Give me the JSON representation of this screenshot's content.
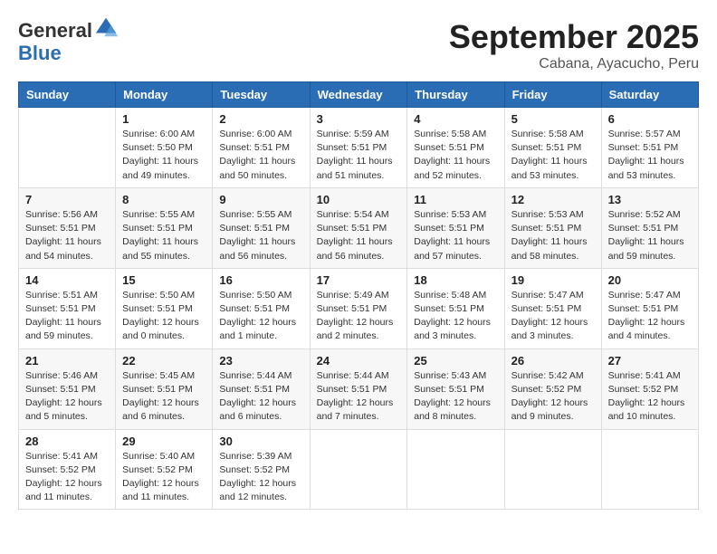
{
  "header": {
    "logo_general": "General",
    "logo_blue": "Blue",
    "month_year": "September 2025",
    "location": "Cabana, Ayacucho, Peru"
  },
  "weekdays": [
    "Sunday",
    "Monday",
    "Tuesday",
    "Wednesday",
    "Thursday",
    "Friday",
    "Saturday"
  ],
  "weeks": [
    [
      {
        "day": "",
        "info": ""
      },
      {
        "day": "1",
        "info": "Sunrise: 6:00 AM\nSunset: 5:50 PM\nDaylight: 11 hours\nand 49 minutes."
      },
      {
        "day": "2",
        "info": "Sunrise: 6:00 AM\nSunset: 5:51 PM\nDaylight: 11 hours\nand 50 minutes."
      },
      {
        "day": "3",
        "info": "Sunrise: 5:59 AM\nSunset: 5:51 PM\nDaylight: 11 hours\nand 51 minutes."
      },
      {
        "day": "4",
        "info": "Sunrise: 5:58 AM\nSunset: 5:51 PM\nDaylight: 11 hours\nand 52 minutes."
      },
      {
        "day": "5",
        "info": "Sunrise: 5:58 AM\nSunset: 5:51 PM\nDaylight: 11 hours\nand 53 minutes."
      },
      {
        "day": "6",
        "info": "Sunrise: 5:57 AM\nSunset: 5:51 PM\nDaylight: 11 hours\nand 53 minutes."
      }
    ],
    [
      {
        "day": "7",
        "info": "Sunrise: 5:56 AM\nSunset: 5:51 PM\nDaylight: 11 hours\nand 54 minutes."
      },
      {
        "day": "8",
        "info": "Sunrise: 5:55 AM\nSunset: 5:51 PM\nDaylight: 11 hours\nand 55 minutes."
      },
      {
        "day": "9",
        "info": "Sunrise: 5:55 AM\nSunset: 5:51 PM\nDaylight: 11 hours\nand 56 minutes."
      },
      {
        "day": "10",
        "info": "Sunrise: 5:54 AM\nSunset: 5:51 PM\nDaylight: 11 hours\nand 56 minutes."
      },
      {
        "day": "11",
        "info": "Sunrise: 5:53 AM\nSunset: 5:51 PM\nDaylight: 11 hours\nand 57 minutes."
      },
      {
        "day": "12",
        "info": "Sunrise: 5:53 AM\nSunset: 5:51 PM\nDaylight: 11 hours\nand 58 minutes."
      },
      {
        "day": "13",
        "info": "Sunrise: 5:52 AM\nSunset: 5:51 PM\nDaylight: 11 hours\nand 59 minutes."
      }
    ],
    [
      {
        "day": "14",
        "info": "Sunrise: 5:51 AM\nSunset: 5:51 PM\nDaylight: 11 hours\nand 59 minutes."
      },
      {
        "day": "15",
        "info": "Sunrise: 5:50 AM\nSunset: 5:51 PM\nDaylight: 12 hours\nand 0 minutes."
      },
      {
        "day": "16",
        "info": "Sunrise: 5:50 AM\nSunset: 5:51 PM\nDaylight: 12 hours\nand 1 minute."
      },
      {
        "day": "17",
        "info": "Sunrise: 5:49 AM\nSunset: 5:51 PM\nDaylight: 12 hours\nand 2 minutes."
      },
      {
        "day": "18",
        "info": "Sunrise: 5:48 AM\nSunset: 5:51 PM\nDaylight: 12 hours\nand 3 minutes."
      },
      {
        "day": "19",
        "info": "Sunrise: 5:47 AM\nSunset: 5:51 PM\nDaylight: 12 hours\nand 3 minutes."
      },
      {
        "day": "20",
        "info": "Sunrise: 5:47 AM\nSunset: 5:51 PM\nDaylight: 12 hours\nand 4 minutes."
      }
    ],
    [
      {
        "day": "21",
        "info": "Sunrise: 5:46 AM\nSunset: 5:51 PM\nDaylight: 12 hours\nand 5 minutes."
      },
      {
        "day": "22",
        "info": "Sunrise: 5:45 AM\nSunset: 5:51 PM\nDaylight: 12 hours\nand 6 minutes."
      },
      {
        "day": "23",
        "info": "Sunrise: 5:44 AM\nSunset: 5:51 PM\nDaylight: 12 hours\nand 6 minutes."
      },
      {
        "day": "24",
        "info": "Sunrise: 5:44 AM\nSunset: 5:51 PM\nDaylight: 12 hours\nand 7 minutes."
      },
      {
        "day": "25",
        "info": "Sunrise: 5:43 AM\nSunset: 5:51 PM\nDaylight: 12 hours\nand 8 minutes."
      },
      {
        "day": "26",
        "info": "Sunrise: 5:42 AM\nSunset: 5:52 PM\nDaylight: 12 hours\nand 9 minutes."
      },
      {
        "day": "27",
        "info": "Sunrise: 5:41 AM\nSunset: 5:52 PM\nDaylight: 12 hours\nand 10 minutes."
      }
    ],
    [
      {
        "day": "28",
        "info": "Sunrise: 5:41 AM\nSunset: 5:52 PM\nDaylight: 12 hours\nand 11 minutes."
      },
      {
        "day": "29",
        "info": "Sunrise: 5:40 AM\nSunset: 5:52 PM\nDaylight: 12 hours\nand 11 minutes."
      },
      {
        "day": "30",
        "info": "Sunrise: 5:39 AM\nSunset: 5:52 PM\nDaylight: 12 hours\nand 12 minutes."
      },
      {
        "day": "",
        "info": ""
      },
      {
        "day": "",
        "info": ""
      },
      {
        "day": "",
        "info": ""
      },
      {
        "day": "",
        "info": ""
      }
    ]
  ]
}
